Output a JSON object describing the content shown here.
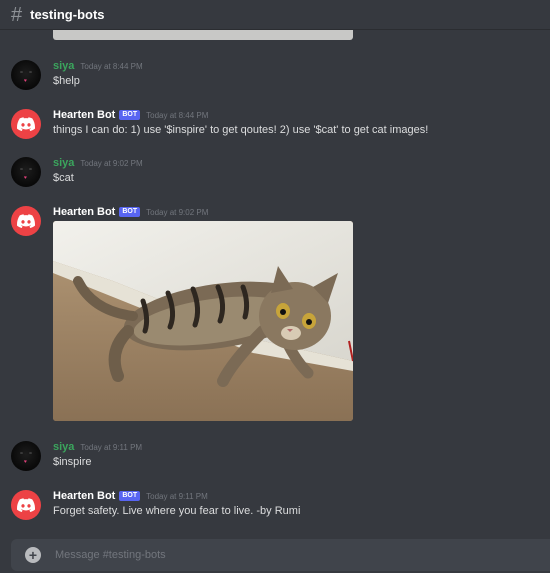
{
  "channel": {
    "hash_icon": "#",
    "name": "testing-bots"
  },
  "icons": {
    "channel": "hash-icon",
    "bot_avatar": "discord-logo-icon",
    "add": "plus-circle-icon"
  },
  "colors": {
    "background": "#36393f",
    "user_name": "#3ba55d",
    "bot_avatar": "#ed4245",
    "bot_tag": "#5865f2"
  },
  "messages": [
    {
      "author": "siya",
      "timestamp": "Today at 8:44 PM",
      "text": "$help"
    },
    {
      "author": "Hearten Bot",
      "tag": "BOT",
      "timestamp": "Today at 8:44 PM",
      "text": "things I can do: 1) use '$inspire' to get qoutes! 2) use '$cat' to get cat images!"
    },
    {
      "author": "siya",
      "timestamp": "Today at 9:02 PM",
      "text": "$cat"
    },
    {
      "author": "Hearten Bot",
      "tag": "BOT",
      "timestamp": "Today at 9:02 PM",
      "attachment": "cat-image"
    },
    {
      "author": "siya",
      "timestamp": "Today at 9:11 PM",
      "text": "$inspire"
    },
    {
      "author": "Hearten Bot",
      "tag": "BOT",
      "timestamp": "Today at 9:11 PM",
      "text": "Forget safety. Live where you fear to live. -by Rumi"
    }
  ],
  "composer": {
    "plus": "+",
    "placeholder": "Message #testing-bots"
  }
}
